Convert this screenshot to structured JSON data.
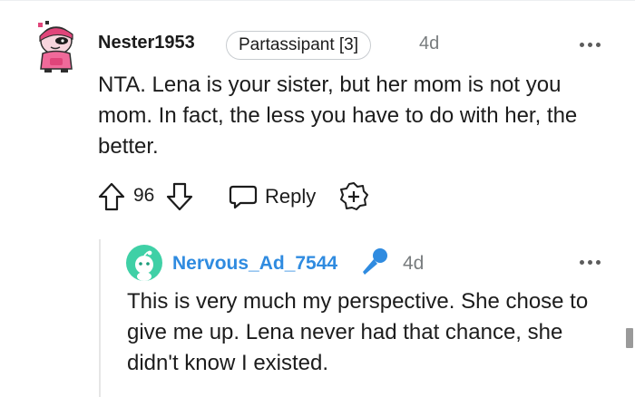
{
  "comment": {
    "author": "Nester1953",
    "flair": "Partassipant [3]",
    "time": "4d",
    "body": "NTA. Lena is your sister, but her mom is not you mom. In fact, the less you have to do with her, the better.",
    "score": "96",
    "reply_label": "Reply",
    "avatar_icon": "snoo-avatar-pink-hoodie",
    "accent_color": "#1c1c1c"
  },
  "reply": {
    "author": "Nervous_Ad_7544",
    "author_color": "#2f8be0",
    "time": "4d",
    "body": "This is very much my perspective. She chose to give me up. Lena never had that chance, she didn't know I existed.",
    "badge_icon": "microphone-icon",
    "avatar_icon": "snoo-avatar-teal"
  }
}
